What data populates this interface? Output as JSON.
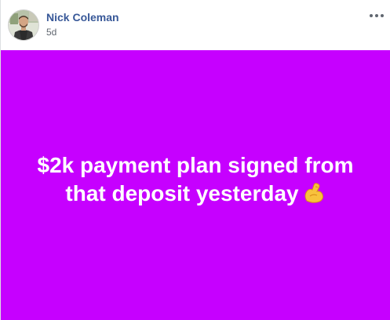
{
  "post": {
    "author_name": "Nick Coleman",
    "time_ago": "5d",
    "status_text": "$2k payment plan signed from that deposit yesterday",
    "background_color": "#c600ff",
    "emoji_icon": "flexed-biceps-icon",
    "more_icon": "more-options-icon",
    "avatar_icon": "profile-avatar"
  }
}
